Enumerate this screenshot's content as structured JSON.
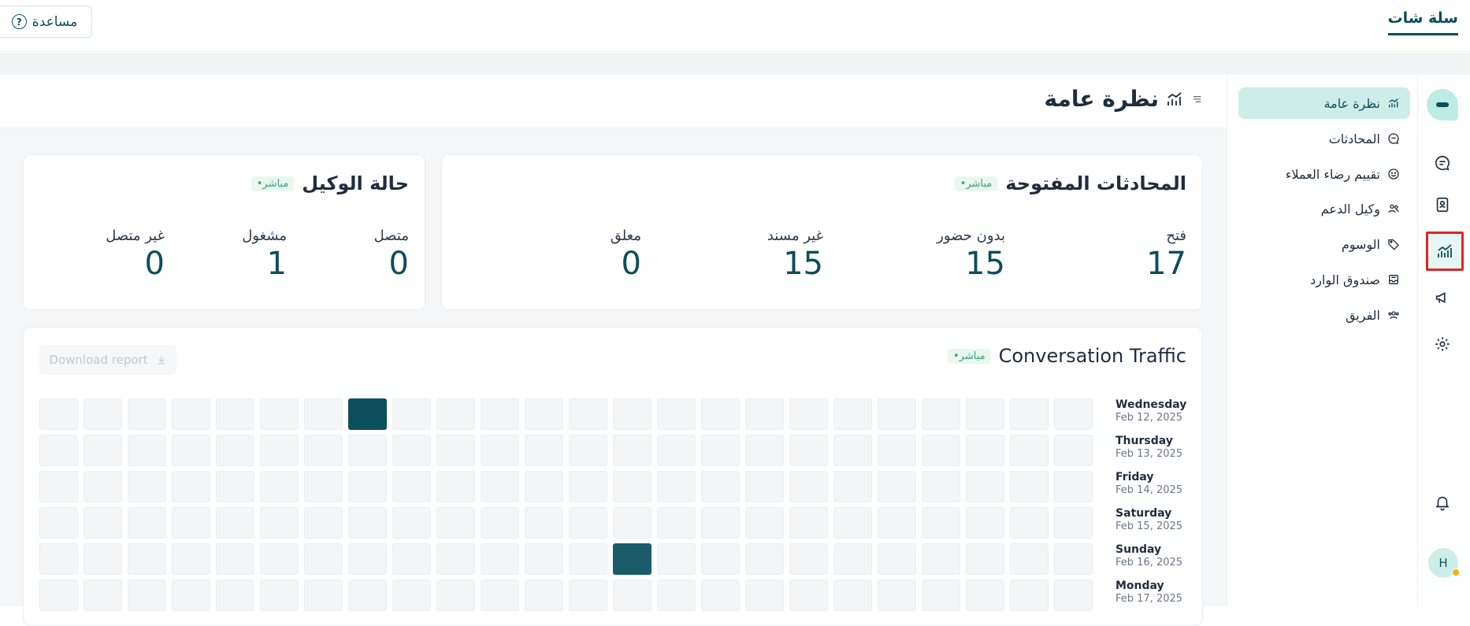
{
  "topbar": {
    "brand": "سلة شات",
    "help_label": "مساعدة"
  },
  "sidenav": {
    "items": [
      {
        "label": "نظرة عامة",
        "icon": "chart-line-icon",
        "active": true
      },
      {
        "label": "المحادثات",
        "icon": "chat-bubble-icon"
      },
      {
        "label": "تقييم رضاء العملاء",
        "icon": "smiley-icon"
      },
      {
        "label": "وكيل الدعم",
        "icon": "users-icon"
      },
      {
        "label": "الوسوم",
        "icon": "tag-icon"
      },
      {
        "label": "صندوق الوارد",
        "icon": "inbox-icon"
      },
      {
        "label": "الفريق",
        "icon": "team-icon"
      }
    ]
  },
  "rail": {
    "avatar_initial": "H"
  },
  "page": {
    "title": "نظرة عامة"
  },
  "open_conversations": {
    "title": "المحادثات المفتوحة",
    "live_label": "•مباشر",
    "stats": [
      {
        "label": "فتح",
        "value": "17"
      },
      {
        "label": "بدون حضور",
        "value": "15"
      },
      {
        "label": "غير مسند",
        "value": "15"
      },
      {
        "label": "معلق",
        "value": "0"
      }
    ]
  },
  "agent_status": {
    "title": "حالة الوكيل",
    "live_label": "•مباشر",
    "stats": [
      {
        "label": "متصل",
        "value": "0"
      },
      {
        "label": "مشغول",
        "value": "1"
      },
      {
        "label": "غير متصل",
        "value": "0"
      }
    ]
  },
  "traffic": {
    "title": "Conversation Traffic",
    "live_label": "•مباشر",
    "download_label": "Download report",
    "days": [
      {
        "name": "Wednesday",
        "date": "Feb 12, 2025"
      },
      {
        "name": "Thursday",
        "date": "Feb 13, 2025"
      },
      {
        "name": "Friday",
        "date": "Feb 14, 2025"
      },
      {
        "name": "Saturday",
        "date": "Feb 15, 2025"
      },
      {
        "name": "Sunday",
        "date": "Feb 16, 2025"
      },
      {
        "name": "Monday",
        "date": "Feb 17, 2025"
      }
    ],
    "columns": 24,
    "highlighted_cells": [
      {
        "row": 0,
        "col": 7,
        "color": "#0b4f5c"
      },
      {
        "row": 4,
        "col": 13,
        "color": "#1a5c69"
      }
    ],
    "empty_color": "#f4f5f6"
  },
  "colors": {
    "accent": "#0d4d5c",
    "active_bg": "#cdeee8",
    "live_text": "#3aa57a",
    "highlight_border": "#e02424"
  }
}
